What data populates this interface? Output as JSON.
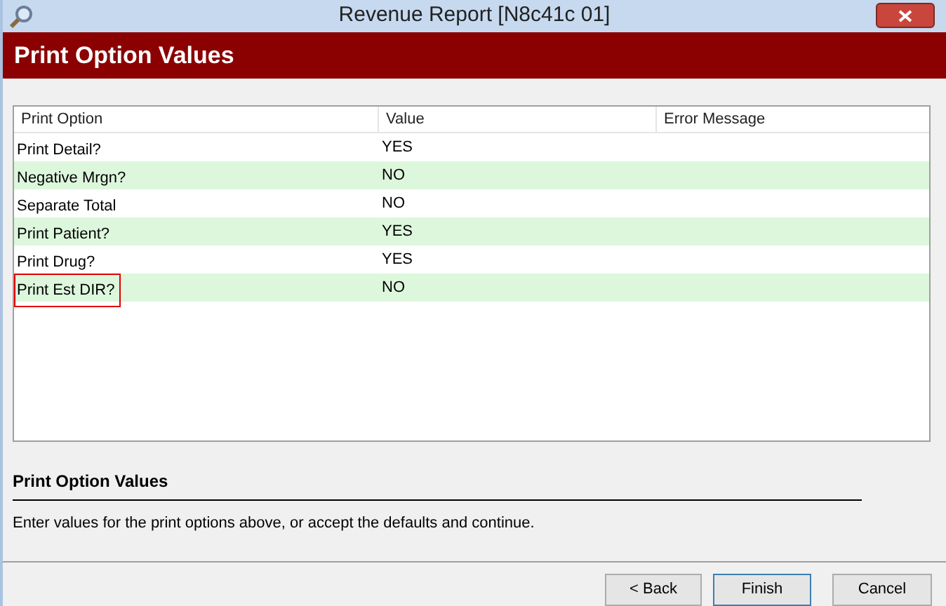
{
  "window": {
    "title": "Revenue Report [N8c41c 01]"
  },
  "header": {
    "title": "Print Option Values"
  },
  "table": {
    "columns": [
      "Print Option",
      "Value",
      "Error Message"
    ],
    "rows": [
      {
        "cells": [
          "Print Detail?",
          "YES",
          ""
        ],
        "selected": false
      },
      {
        "cells": [
          "Negative Mrgn?",
          "NO",
          ""
        ],
        "selected": false
      },
      {
        "cells": [
          "Separate Total",
          "NO",
          ""
        ],
        "selected": false
      },
      {
        "cells": [
          "Print Patient?",
          "YES",
          ""
        ],
        "selected": false
      },
      {
        "cells": [
          "Print Drug?",
          "YES",
          ""
        ],
        "selected": false
      },
      {
        "cells": [
          "Print Est DIR?",
          "NO",
          ""
        ],
        "selected": true
      }
    ]
  },
  "help": {
    "title": "Print Option Values",
    "text": "Enter values for the print options above, or accept the defaults and continue."
  },
  "buttons": [
    {
      "label": "< Back",
      "default": false
    },
    {
      "label": "Finish",
      "default": true
    },
    {
      "label": "Cancel",
      "default": false
    }
  ]
}
